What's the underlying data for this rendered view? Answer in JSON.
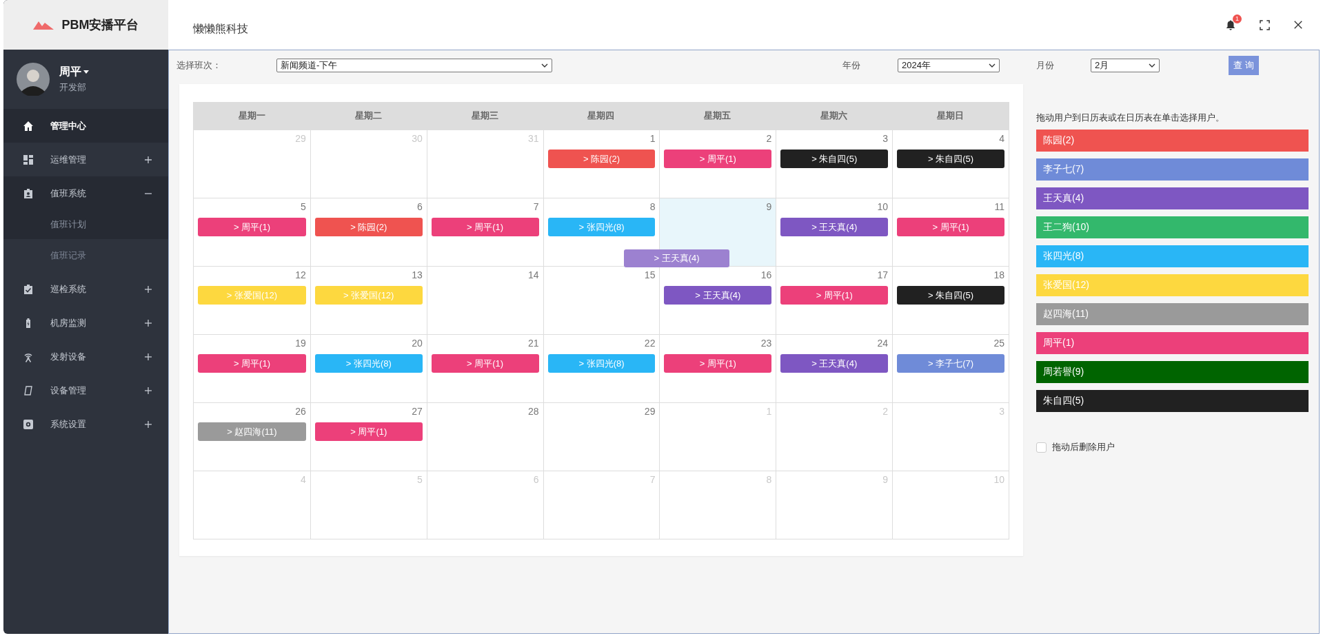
{
  "brand": {
    "name": "PBM安播平台"
  },
  "user": {
    "name": "周平",
    "department": "开发部"
  },
  "sidebar": {
    "items": [
      {
        "label": "管理中心",
        "selected": true
      },
      {
        "label": "运维管理",
        "selected": false,
        "expanded": false
      },
      {
        "label": "值班系统",
        "selected": false,
        "expanded": true,
        "children": [
          {
            "label": "值班计划",
            "selected": true
          },
          {
            "label": "值班记录",
            "selected": false
          }
        ]
      },
      {
        "label": "巡检系统",
        "selected": false,
        "expanded": false
      },
      {
        "label": "机房监测",
        "selected": false,
        "expanded": false
      },
      {
        "label": "发射设备",
        "selected": false,
        "expanded": false
      },
      {
        "label": "设备管理",
        "selected": false,
        "expanded": false
      },
      {
        "label": "系统设置",
        "selected": false,
        "expanded": false
      }
    ]
  },
  "header": {
    "title": "懒懒熊科技",
    "notification_count": "1"
  },
  "filters": {
    "shift_label": "选择班次：",
    "shift_value": "新闻频道-下午",
    "year_label": "年份",
    "year_value": "2024年",
    "month_label": "月份",
    "month_value": "2月",
    "query_button": "查 询"
  },
  "calendar": {
    "weekdays": [
      "星期一",
      "星期二",
      "星期三",
      "星期四",
      "星期五",
      "星期六",
      "星期日"
    ],
    "weeks": [
      [
        {
          "day": "29",
          "other_month": true,
          "today": false
        },
        {
          "day": "30",
          "other_month": true,
          "today": false
        },
        {
          "day": "31",
          "other_month": true,
          "today": false
        },
        {
          "day": "1",
          "other_month": false,
          "today": false,
          "events": [
            {
              "label": "> 陈园(2)",
              "color": "#ef5350"
            }
          ]
        },
        {
          "day": "2",
          "other_month": false,
          "today": false,
          "events": [
            {
              "label": "> 周平(1)",
              "color": "#ec407a"
            }
          ]
        },
        {
          "day": "3",
          "other_month": false,
          "today": false,
          "events": [
            {
              "label": "> 朱自四(5)",
              "color": "#212121"
            }
          ]
        },
        {
          "day": "4",
          "other_month": false,
          "today": false,
          "events": [
            {
              "label": "> 朱自四(5)",
              "color": "#212121"
            }
          ]
        }
      ],
      [
        {
          "day": "5",
          "other_month": false,
          "today": false,
          "events": [
            {
              "label": "> 周平(1)",
              "color": "#ec407a"
            }
          ]
        },
        {
          "day": "6",
          "other_month": false,
          "today": false,
          "events": [
            {
              "label": "> 陈园(2)",
              "color": "#ef5350"
            }
          ]
        },
        {
          "day": "7",
          "other_month": false,
          "today": false,
          "events": [
            {
              "label": "> 周平(1)",
              "color": "#ec407a"
            }
          ]
        },
        {
          "day": "8",
          "other_month": false,
          "today": false,
          "events": [
            {
              "label": "> 张四光(8)",
              "color": "#29b6f6"
            }
          ]
        },
        {
          "day": "9",
          "other_month": false,
          "today": true
        },
        {
          "day": "10",
          "other_month": false,
          "today": false,
          "events": [
            {
              "label": "> 王天真(4)",
              "color": "#7e57c2"
            }
          ]
        },
        {
          "day": "11",
          "other_month": false,
          "today": false,
          "events": [
            {
              "label": "> 周平(1)",
              "color": "#ec407a"
            }
          ]
        }
      ],
      [
        {
          "day": "12",
          "other_month": false,
          "today": false,
          "events": [
            {
              "label": "> 张爱国(12)",
              "color": "#fdd83f"
            }
          ]
        },
        {
          "day": "13",
          "other_month": false,
          "today": false,
          "events": [
            {
              "label": "> 张爱国(12)",
              "color": "#fdd83f"
            }
          ]
        },
        {
          "day": "14",
          "other_month": false,
          "today": false
        },
        {
          "day": "15",
          "other_month": false,
          "today": false
        },
        {
          "day": "16",
          "other_month": false,
          "today": false,
          "events": [
            {
              "label": "> 王天真(4)",
              "color": "#7e57c2"
            }
          ]
        },
        {
          "day": "17",
          "other_month": false,
          "today": false,
          "events": [
            {
              "label": "> 周平(1)",
              "color": "#ec407a"
            }
          ]
        },
        {
          "day": "18",
          "other_month": false,
          "today": false,
          "events": [
            {
              "label": "> 朱自四(5)",
              "color": "#212121"
            }
          ]
        }
      ],
      [
        {
          "day": "19",
          "other_month": false,
          "today": false,
          "events": [
            {
              "label": "> 周平(1)",
              "color": "#ec407a"
            }
          ]
        },
        {
          "day": "20",
          "other_month": false,
          "today": false,
          "events": [
            {
              "label": "> 张四光(8)",
              "color": "#29b6f6"
            }
          ]
        },
        {
          "day": "21",
          "other_month": false,
          "today": false,
          "events": [
            {
              "label": "> 周平(1)",
              "color": "#ec407a"
            }
          ]
        },
        {
          "day": "22",
          "other_month": false,
          "today": false,
          "events": [
            {
              "label": "> 张四光(8)",
              "color": "#29b6f6"
            }
          ]
        },
        {
          "day": "23",
          "other_month": false,
          "today": false,
          "events": [
            {
              "label": "> 周平(1)",
              "color": "#ec407a"
            }
          ]
        },
        {
          "day": "24",
          "other_month": false,
          "today": false,
          "events": [
            {
              "label": "> 王天真(4)",
              "color": "#7e57c2"
            }
          ]
        },
        {
          "day": "25",
          "other_month": false,
          "today": false,
          "events": [
            {
              "label": "> 李子七(7)",
              "color": "#6f8bd8"
            }
          ]
        }
      ],
      [
        {
          "day": "26",
          "other_month": false,
          "today": false,
          "events": [
            {
              "label": "> 赵四海(11)",
              "color": "#9a9a9a"
            }
          ]
        },
        {
          "day": "27",
          "other_month": false,
          "today": false,
          "events": [
            {
              "label": "> 周平(1)",
              "color": "#ec407a"
            }
          ]
        },
        {
          "day": "28",
          "other_month": false,
          "today": false
        },
        {
          "day": "29",
          "other_month": false,
          "today": false
        },
        {
          "day": "1",
          "other_month": true,
          "today": false
        },
        {
          "day": "2",
          "other_month": true,
          "today": false
        },
        {
          "day": "3",
          "other_month": true,
          "today": false
        }
      ],
      [
        {
          "day": "4",
          "other_month": true,
          "today": false
        },
        {
          "day": "5",
          "other_month": true,
          "today": false
        },
        {
          "day": "6",
          "other_month": true,
          "today": false
        },
        {
          "day": "7",
          "other_month": true,
          "today": false
        },
        {
          "day": "8",
          "other_month": true,
          "today": false
        },
        {
          "day": "9",
          "other_month": true,
          "today": false
        },
        {
          "day": "10",
          "other_month": true,
          "today": false
        }
      ]
    ],
    "dragged_event": {
      "label": "> 王天真(4)"
    }
  },
  "users_panel": {
    "hint": "拖动用户到日历表或在日历表在单击选择用户。",
    "users": [
      {
        "label": "陈园(2)",
        "color": "#ef5350"
      },
      {
        "label": "李子七(7)",
        "color": "#6f8bd8"
      },
      {
        "label": "王天真(4)",
        "color": "#7e57c2"
      },
      {
        "label": "王二狗(10)",
        "color": "#33b86c"
      },
      {
        "label": "张四光(8)",
        "color": "#29b6f6"
      },
      {
        "label": "张爱国(12)",
        "color": "#fdd83f"
      },
      {
        "label": "赵四海(11)",
        "color": "#9a9a9a"
      },
      {
        "label": "周平(1)",
        "color": "#ec407a"
      },
      {
        "label": "周若譽(9)",
        "color": "#006400"
      },
      {
        "label": "朱自四(5)",
        "color": "#212121"
      }
    ],
    "remove_after_drag": {
      "label": "拖动后删除用户",
      "checked": false
    }
  }
}
